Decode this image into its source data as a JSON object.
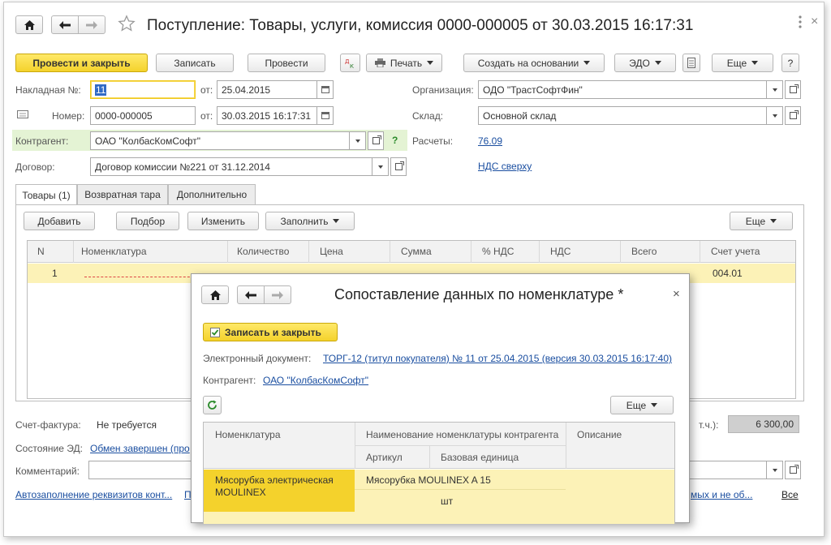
{
  "window": {
    "title": "Поступление: Товары, услуги, комиссия 0000-000005 от 30.03.2015 16:17:31"
  },
  "toolbar": {
    "post_close": "Провести и закрыть",
    "save": "Записать",
    "post": "Провести",
    "print": "Печать",
    "create_basis": "Создать на основании",
    "edo": "ЭДО",
    "more": "Еще",
    "help": "?"
  },
  "form": {
    "invoice_label": "Накладная №:",
    "invoice_value": "11",
    "from_label": "от:",
    "invoice_date": "25.04.2015",
    "number_label": "Номер:",
    "number_value": "0000-000005",
    "number_date": "30.03.2015 16:17:31",
    "contractor_label": "Контрагент:",
    "contractor_value": "ОАО \"КолбасКомСофт\"",
    "contract_label": "Договор:",
    "contract_value": "Договор комиссии №221 от 31.12.2014",
    "org_label": "Организация:",
    "org_value": "ОДО \"ТрастСофтФин\"",
    "warehouse_label": "Склад:",
    "warehouse_value": "Основной склад",
    "settlements_label": "Расчеты:",
    "settlements_value": "76.09",
    "vat_link": "НДС сверху"
  },
  "tabs": [
    {
      "label": "Товары (1)"
    },
    {
      "label": "Возвратная тара"
    },
    {
      "label": "Дополнительно"
    }
  ],
  "goods_toolbar": {
    "add": "Добавить",
    "pick": "Подбор",
    "edit": "Изменить",
    "fill": "Заполнить",
    "more": "Еще"
  },
  "table": {
    "headers": [
      "N",
      "Номенклатура",
      "Количество",
      "Цена",
      "Сумма",
      "% НДС",
      "НДС",
      "Всего",
      "Счет учета"
    ],
    "row": {
      "n": "1",
      "account": "004.01"
    }
  },
  "footer": {
    "invoice_label": "Счет-фактура:",
    "invoice_value": "Не требуется",
    "ed_state_label": "Состояние ЭД:",
    "ed_state_value": "Обмен завершен (про",
    "comment_label": "Комментарий:",
    "autofill_link": "Автозаполнение реквизитов конт...",
    "right_link_tail": "мых и не об...",
    "all_link": "Все",
    "total_suffix": "т.ч.):",
    "total_value": "6 300,00"
  },
  "dialog": {
    "title": "Сопоставление данных по номенклатуре *",
    "save_close": "Записать и закрыть",
    "doc_label": "Электронный документ:",
    "doc_link": "ТОРГ-12 (титул покупателя) № 11 от 25.04.2015 (версия 30.03.2015 16:17:40)",
    "contractor_label": "Контрагент:",
    "contractor_link": "ОАО \"КолбасКомСофт\"",
    "more": "Еще",
    "headers": {
      "nomenclature": "Номенклатура",
      "contractor_name": "Наименование номенклатуры контрагента",
      "description": "Описание",
      "article": "Артикул",
      "base_unit": "Базовая единица"
    },
    "row": {
      "nomenclature": "Мясорубка электрическая MOULINEX",
      "contractor_name": "Мясорубка MOULINEX  A 15",
      "unit": "шт"
    }
  },
  "colors": {
    "accent_yellow": "#f4d22c",
    "row_yellow": "#fcf2b7",
    "link_blue": "#1a4ea0",
    "green_field": "#e4f3d4"
  }
}
